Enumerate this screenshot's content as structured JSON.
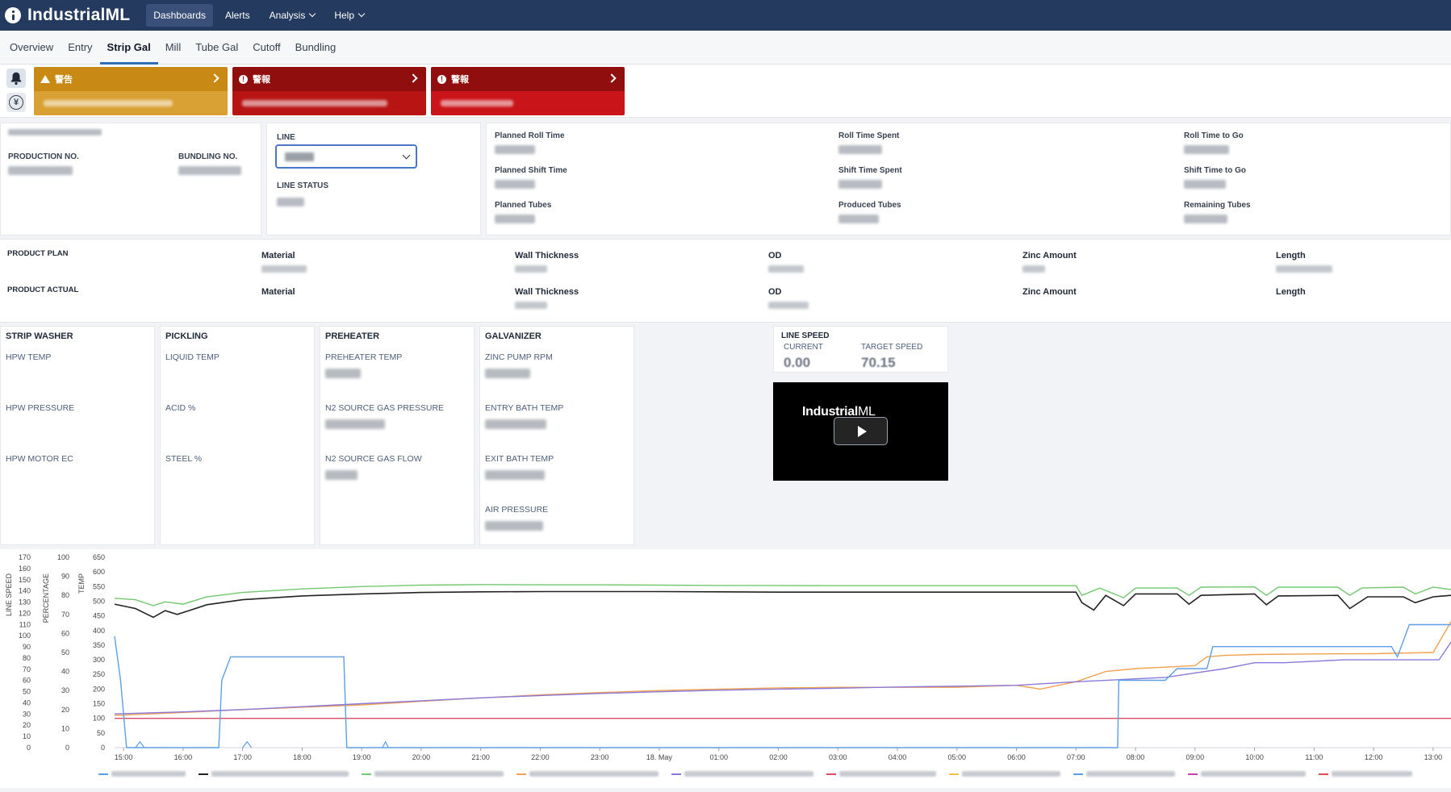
{
  "app": {
    "name": "IndustrialML"
  },
  "nav": [
    {
      "label": "Dashboards",
      "active": true,
      "dropdown": false
    },
    {
      "label": "Alerts",
      "active": false,
      "dropdown": false
    },
    {
      "label": "Analysis",
      "active": false,
      "dropdown": true
    },
    {
      "label": "Help",
      "active": false,
      "dropdown": true
    }
  ],
  "tabs": [
    {
      "label": "Overview"
    },
    {
      "label": "Entry"
    },
    {
      "label": "Strip Gal",
      "active": true
    },
    {
      "label": "Mill"
    },
    {
      "label": "Tube Gal"
    },
    {
      "label": "Cutoff"
    },
    {
      "label": "Bundling"
    }
  ],
  "alerts": [
    {
      "title": "警告",
      "color": "#c88a14",
      "body_color": "#d9a033"
    },
    {
      "title": "警報",
      "color": "#900e0e",
      "body_color": "#b81414"
    },
    {
      "title": "警報",
      "color": "#900e0e",
      "body_color": "#c9141a"
    }
  ],
  "production": {
    "production_no_label": "PRODUCTION NO.",
    "bundling_no_label": "BUNDLING NO."
  },
  "line": {
    "label": "LINE",
    "status_label": "LINE STATUS"
  },
  "times": {
    "planned_roll_time": "Planned Roll Time",
    "roll_time_spent": "Roll Time Spent",
    "roll_time_to_go": "Roll Time to Go",
    "planned_shift_time": "Planned Shift Time",
    "shift_time_spent": "Shift Time Spent",
    "shift_time_to_go": "Shift Time to Go",
    "planned_tubes": "Planned Tubes",
    "produced_tubes": "Produced Tubes",
    "remaining_tubes": "Remaining Tubes"
  },
  "product": {
    "plan_label": "PRODUCT PLAN",
    "actual_label": "PRODUCT ACTUAL",
    "material": "Material",
    "wall_thickness": "Wall Thickness",
    "od": "OD",
    "zinc_amount": "Zinc Amount",
    "length": "Length"
  },
  "sections": {
    "strip_washer": {
      "title": "STRIP WASHER",
      "items": [
        "HPW TEMP",
        "HPW PRESSURE",
        "HPW MOTOR EC"
      ]
    },
    "pickling": {
      "title": "PICKLING",
      "items": [
        "LIQUID TEMP",
        "ACID %",
        "STEEL %"
      ]
    },
    "preheater": {
      "title": "PREHEATER",
      "items": [
        "PREHEATER TEMP",
        "N2 SOURCE GAS PRESSURE",
        "N2 SOURCE GAS FLOW"
      ]
    },
    "galvanizer": {
      "title": "GALVANIZER",
      "items": [
        "ZINC PUMP RPM",
        "ENTRY BATH TEMP",
        "EXIT BATH TEMP",
        "AIR PRESSURE"
      ]
    }
  },
  "line_speed": {
    "title": "LINE SPEED",
    "current_label": "CURRENT",
    "target_label": "TARGET SPEED",
    "current_value": "0.00",
    "target_value": "70.15"
  },
  "video": {
    "brand_bold": "Industrial",
    "brand_light": "ML"
  },
  "chart_data": {
    "type": "line",
    "axes": [
      {
        "label": "LINE SPEED",
        "ticks": [
          0,
          10,
          20,
          30,
          40,
          50,
          60,
          70,
          80,
          90,
          100,
          110,
          120,
          130,
          140,
          150,
          160,
          170
        ]
      },
      {
        "label": "PERCENTAGE",
        "ticks": [
          0,
          10,
          20,
          30,
          40,
          50,
          60,
          70,
          80,
          90,
          100
        ]
      },
      {
        "label": "TEMP",
        "ticks": [
          0,
          50,
          100,
          150,
          200,
          250,
          300,
          350,
          400,
          450,
          500,
          550,
          600,
          650
        ]
      }
    ],
    "x_ticks": [
      "15:00",
      "16:00",
      "17:00",
      "18:00",
      "19:00",
      "20:00",
      "21:00",
      "22:00",
      "23:00",
      "18. May",
      "01:00",
      "02:00",
      "03:00",
      "04:00",
      "05:00",
      "06:00",
      "07:00",
      "08:00",
      "09:00",
      "10:00",
      "11:00",
      "12:00",
      "13:00"
    ],
    "x_range": [
      14.85,
      37.3
    ],
    "temp_range": [
      0,
      650
    ],
    "series": [
      {
        "color": "#72c86e",
        "points": [
          [
            14.85,
            510
          ],
          [
            15.2,
            505
          ],
          [
            15.5,
            485
          ],
          [
            15.7,
            498
          ],
          [
            16.0,
            490
          ],
          [
            16.4,
            515
          ],
          [
            17,
            530
          ],
          [
            18,
            542
          ],
          [
            19,
            550
          ],
          [
            20,
            555
          ],
          [
            21,
            557
          ],
          [
            22,
            556
          ],
          [
            23,
            556
          ],
          [
            24,
            555
          ],
          [
            25,
            554
          ],
          [
            26,
            554
          ],
          [
            27,
            553
          ],
          [
            28,
            553
          ],
          [
            29,
            553
          ],
          [
            30,
            553
          ],
          [
            31,
            553
          ],
          [
            31.1,
            520
          ],
          [
            31.4,
            545
          ],
          [
            31.8,
            512
          ],
          [
            32.0,
            545
          ],
          [
            32.7,
            545
          ],
          [
            32.9,
            520
          ],
          [
            33.1,
            548
          ],
          [
            34.0,
            549
          ],
          [
            34.2,
            520
          ],
          [
            34.4,
            548
          ],
          [
            35.4,
            548
          ],
          [
            35.6,
            520
          ],
          [
            35.8,
            545
          ],
          [
            36.5,
            548
          ],
          [
            36.7,
            525
          ],
          [
            37.0,
            548
          ],
          [
            37.3,
            540
          ]
        ]
      },
      {
        "color": "#222222",
        "points": [
          [
            14.85,
            490
          ],
          [
            15.2,
            475
          ],
          [
            15.5,
            445
          ],
          [
            15.7,
            468
          ],
          [
            15.9,
            455
          ],
          [
            16.1,
            468
          ],
          [
            16.4,
            488
          ],
          [
            17,
            505
          ],
          [
            18,
            518
          ],
          [
            19,
            525
          ],
          [
            20,
            530
          ],
          [
            21,
            532
          ],
          [
            22,
            533
          ],
          [
            23,
            533
          ],
          [
            24,
            533
          ],
          [
            25,
            532
          ],
          [
            26,
            531
          ],
          [
            27,
            531
          ],
          [
            28,
            531
          ],
          [
            29,
            531
          ],
          [
            30,
            531
          ],
          [
            31,
            531
          ],
          [
            31.1,
            495
          ],
          [
            31.3,
            470
          ],
          [
            31.5,
            520
          ],
          [
            31.8,
            485
          ],
          [
            32.0,
            525
          ],
          [
            32.7,
            525
          ],
          [
            32.9,
            490
          ],
          [
            33.1,
            520
          ],
          [
            34.0,
            525
          ],
          [
            34.2,
            488
          ],
          [
            34.4,
            518
          ],
          [
            35.4,
            520
          ],
          [
            35.6,
            475
          ],
          [
            35.9,
            515
          ],
          [
            36.5,
            515
          ],
          [
            36.7,
            495
          ],
          [
            37.0,
            515
          ],
          [
            37.3,
            520
          ]
        ]
      },
      {
        "color": "#f2a250",
        "points": [
          [
            14.85,
            110
          ],
          [
            16,
            120
          ],
          [
            17,
            130
          ],
          [
            18,
            138
          ],
          [
            19,
            146
          ],
          [
            20,
            158
          ],
          [
            21,
            170
          ],
          [
            22,
            180
          ],
          [
            23,
            188
          ],
          [
            24,
            195
          ],
          [
            25,
            200
          ],
          [
            26,
            204
          ],
          [
            27,
            206
          ],
          [
            28,
            206
          ],
          [
            29,
            206
          ],
          [
            30,
            213
          ],
          [
            30.4,
            200
          ],
          [
            31,
            225
          ],
          [
            31.5,
            260
          ],
          [
            32,
            270
          ],
          [
            32.5,
            275
          ],
          [
            33,
            280
          ],
          [
            33.2,
            310
          ],
          [
            33.5,
            315
          ],
          [
            34,
            318
          ],
          [
            35,
            320
          ],
          [
            36,
            321
          ],
          [
            37,
            325
          ],
          [
            37.3,
            430
          ]
        ]
      },
      {
        "color": "#8b78da",
        "points": [
          [
            14.85,
            115
          ],
          [
            16,
            122
          ],
          [
            17,
            130
          ],
          [
            18,
            140
          ],
          [
            19,
            150
          ],
          [
            20,
            160
          ],
          [
            21,
            170
          ],
          [
            22,
            178
          ],
          [
            23,
            185
          ],
          [
            24,
            191
          ],
          [
            25,
            196
          ],
          [
            26,
            200
          ],
          [
            27,
            203
          ],
          [
            28,
            207
          ],
          [
            29,
            210
          ],
          [
            30,
            213
          ],
          [
            31,
            225
          ],
          [
            32,
            235
          ],
          [
            32.5,
            240
          ],
          [
            33,
            255
          ],
          [
            33.5,
            270
          ],
          [
            34,
            290
          ],
          [
            34.5,
            290
          ],
          [
            35,
            295
          ],
          [
            35.5,
            300
          ],
          [
            36,
            300
          ],
          [
            36.5,
            300
          ],
          [
            37,
            300
          ],
          [
            37.1,
            300
          ],
          [
            37.3,
            360
          ]
        ]
      },
      {
        "color": "#d94a6a",
        "points": [
          [
            14.85,
            100
          ],
          [
            37.3,
            100
          ]
        ]
      },
      {
        "color": "#5e9ee6",
        "points": [
          [
            14.85,
            380
          ],
          [
            14.95,
            230
          ],
          [
            15.05,
            0
          ],
          [
            16.6,
            0
          ],
          [
            16.65,
            230
          ],
          [
            16.8,
            310
          ],
          [
            18.7,
            310
          ],
          [
            18.75,
            0
          ],
          [
            31.7,
            0
          ],
          [
            31.72,
            230
          ],
          [
            32.5,
            230
          ],
          [
            32.7,
            270
          ],
          [
            33.2,
            270
          ],
          [
            33.3,
            345
          ],
          [
            36.3,
            345
          ],
          [
            36.4,
            310
          ],
          [
            36.6,
            420
          ],
          [
            37.3,
            420
          ]
        ]
      }
    ]
  },
  "colors": {
    "topbar": "#243a5e",
    "accent": "#2f6eb5"
  }
}
